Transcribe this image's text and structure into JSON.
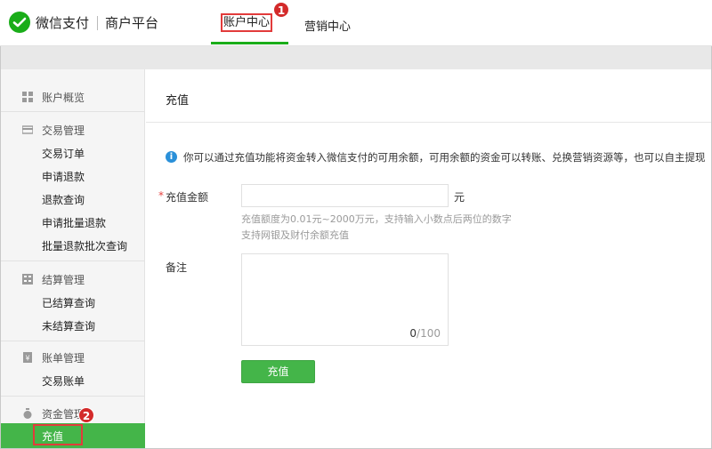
{
  "header": {
    "brand": "微信支付",
    "platform": "商户平台",
    "tabs": [
      {
        "label": "账户中心",
        "active": true
      },
      {
        "label": "营销中心",
        "active": false
      }
    ],
    "badge1": "1",
    "accent": "#1aad19"
  },
  "sidebar": {
    "overview": "账户概览",
    "groups": [
      {
        "title": "交易管理",
        "items": [
          "交易订单",
          "申请退款",
          "退款查询",
          "申请批量退款",
          "批量退款批次查询"
        ]
      },
      {
        "title": "结算管理",
        "items": [
          "已结算查询",
          "未结算查询"
        ]
      },
      {
        "title": "账单管理",
        "items": [
          "交易账单"
        ]
      },
      {
        "title": "资金管理",
        "items": [
          "充值"
        ]
      }
    ],
    "badge2": "2"
  },
  "main": {
    "title": "充值",
    "info": "你可以通过充值功能将资金转入微信支付的可用余额，可用余额的资金可以转账、兑换营销资源等，也可以自主提现",
    "required_mark": "*",
    "amount_label": "充值金额",
    "amount_value": "",
    "unit": "元",
    "hint1": "充值额度为0.01元~2000万元，支持输入小数点后两位的数字",
    "hint2": "支持网银及财付余额充值",
    "remark_label": "备注",
    "remark_value": "",
    "counter_current": "0",
    "counter_max": "/100",
    "submit": "充值"
  }
}
